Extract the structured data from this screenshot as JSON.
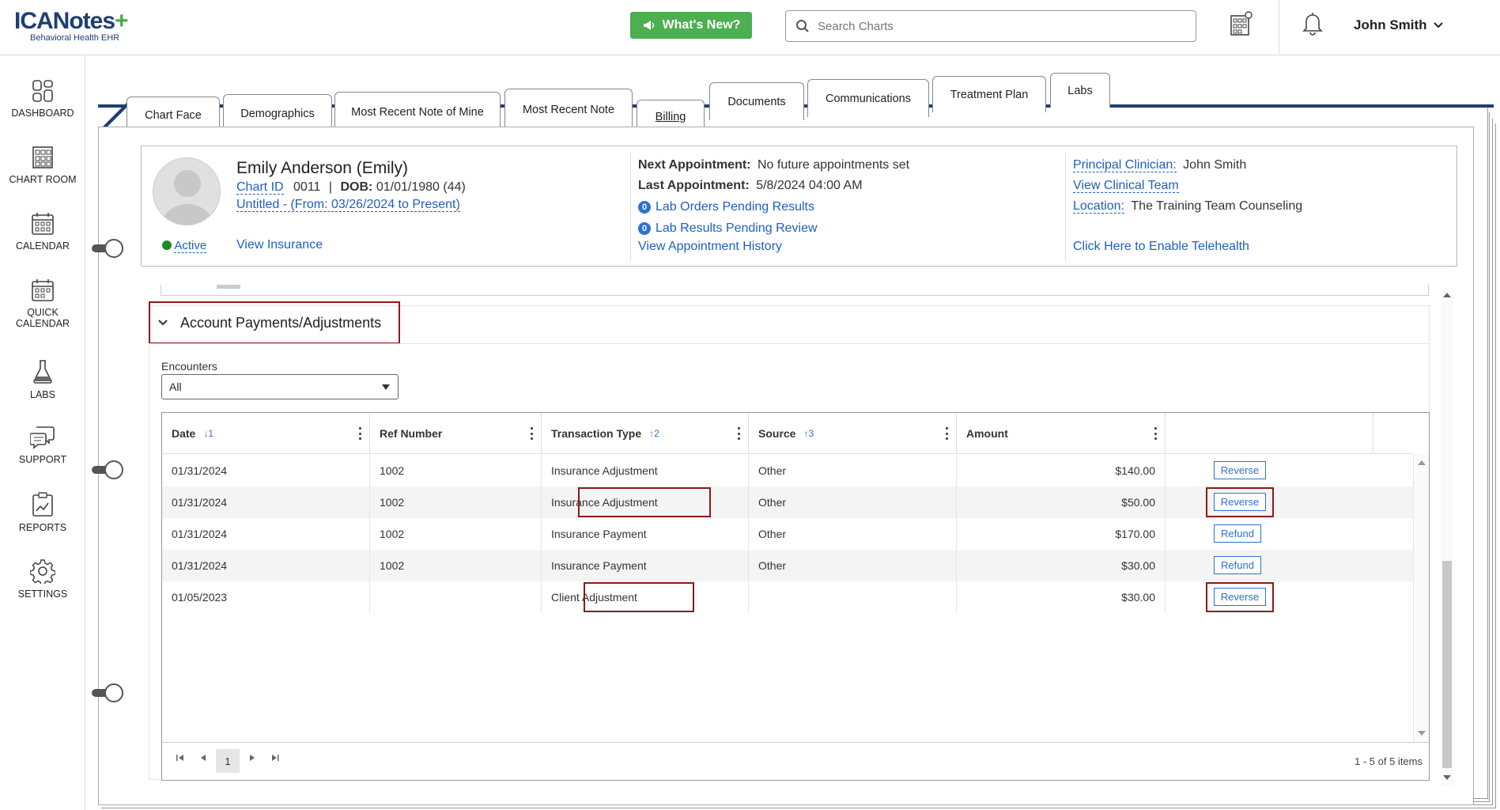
{
  "brand": {
    "name": "ICANotes",
    "plus": "+",
    "tagline": "Behavioral Health EHR"
  },
  "topbar": {
    "whats_new": "What's New?",
    "search_placeholder": "Search Charts",
    "user_name": "John Smith"
  },
  "sidebar": {
    "items": [
      {
        "label": "DASHBOARD",
        "icon": "dashboard-icon"
      },
      {
        "label": "CHART ROOM",
        "icon": "chart-room-icon"
      },
      {
        "label": "CALENDAR",
        "icon": "calendar-icon"
      },
      {
        "label": "QUICK CALENDAR",
        "label1": "QUICK",
        "label2": "CALENDAR",
        "icon": "quick-calendar-icon"
      },
      {
        "label": "LABS",
        "icon": "flask-icon"
      },
      {
        "label": "SUPPORT",
        "icon": "support-chat-icon"
      },
      {
        "label": "REPORTS",
        "icon": "reports-icon"
      },
      {
        "label": "SETTINGS",
        "icon": "gear-icon"
      }
    ]
  },
  "tabs": [
    {
      "label": "Chart Face"
    },
    {
      "label": "Demographics"
    },
    {
      "label": "Most Recent Note of Mine"
    },
    {
      "label": "Most Recent Note"
    },
    {
      "label": "Billing",
      "active": true
    },
    {
      "label": "Documents"
    },
    {
      "label": "Communications"
    },
    {
      "label": "Treatment Plan"
    },
    {
      "label": "Labs"
    }
  ],
  "patient": {
    "name": "Emily Anderson (Emily)",
    "chart_id_label": "Chart ID",
    "chart_id": "0011",
    "dob_label": "DOB:",
    "dob": "01/01/1980 (44)",
    "episode": "Untitled - (From: 03/26/2024 to Present)",
    "status": "Active",
    "view_insurance": "View Insurance",
    "next_appt_label": "Next Appointment:",
    "next_appt": "No future appointments set",
    "last_appt_label": "Last Appointment:",
    "last_appt": "5/8/2024 04:00 AM",
    "lab_pending_count": "0",
    "lab_pending": "Lab Orders Pending Results",
    "lab_review_count": "0",
    "lab_review": "Lab Results Pending Review",
    "appt_history": "View Appointment History",
    "principal_label": "Principal Clinician:",
    "principal": "John Smith",
    "clinical_team": "View Clinical Team",
    "location_label": "Location:",
    "location": "The Training Team Counseling",
    "telehealth": "Click Here to Enable Telehealth"
  },
  "section": {
    "title": "Account Payments/Adjustments",
    "encounters_label": "Encounters",
    "encounters_value": "All"
  },
  "grid": {
    "columns": [
      {
        "label": "Date",
        "sort": "↓1"
      },
      {
        "label": "Ref Number",
        "sort": ""
      },
      {
        "label": "Transaction Type",
        "sort": "↑2"
      },
      {
        "label": "Source",
        "sort": "↑3"
      },
      {
        "label": "Amount",
        "sort": ""
      }
    ],
    "rows": [
      {
        "date": "01/31/2024",
        "ref": "1002",
        "type": "Insurance Adjustment",
        "source": "Other",
        "amount": "$140.00",
        "action": "Reverse"
      },
      {
        "date": "01/31/2024",
        "ref": "1002",
        "type": "Insurance Adjustment",
        "source": "Other",
        "amount": "$50.00",
        "action": "Reverse"
      },
      {
        "date": "01/31/2024",
        "ref": "1002",
        "type": "Insurance Payment",
        "source": "Other",
        "amount": "$170.00",
        "action": "Refund"
      },
      {
        "date": "01/31/2024",
        "ref": "1002",
        "type": "Insurance Payment",
        "source": "Other",
        "amount": "$30.00",
        "action": "Refund"
      },
      {
        "date": "01/05/2023",
        "ref": "",
        "type": "Client Adjustment",
        "source": "",
        "amount": "$30.00",
        "action": "Reverse"
      }
    ],
    "page": "1",
    "items_summary": "1 - 5 of 5 items"
  },
  "colors": {
    "accent": "#2d72d2",
    "highlight": "#8b1a1a",
    "green": "#4caf50",
    "brand": "#1f3e73"
  }
}
